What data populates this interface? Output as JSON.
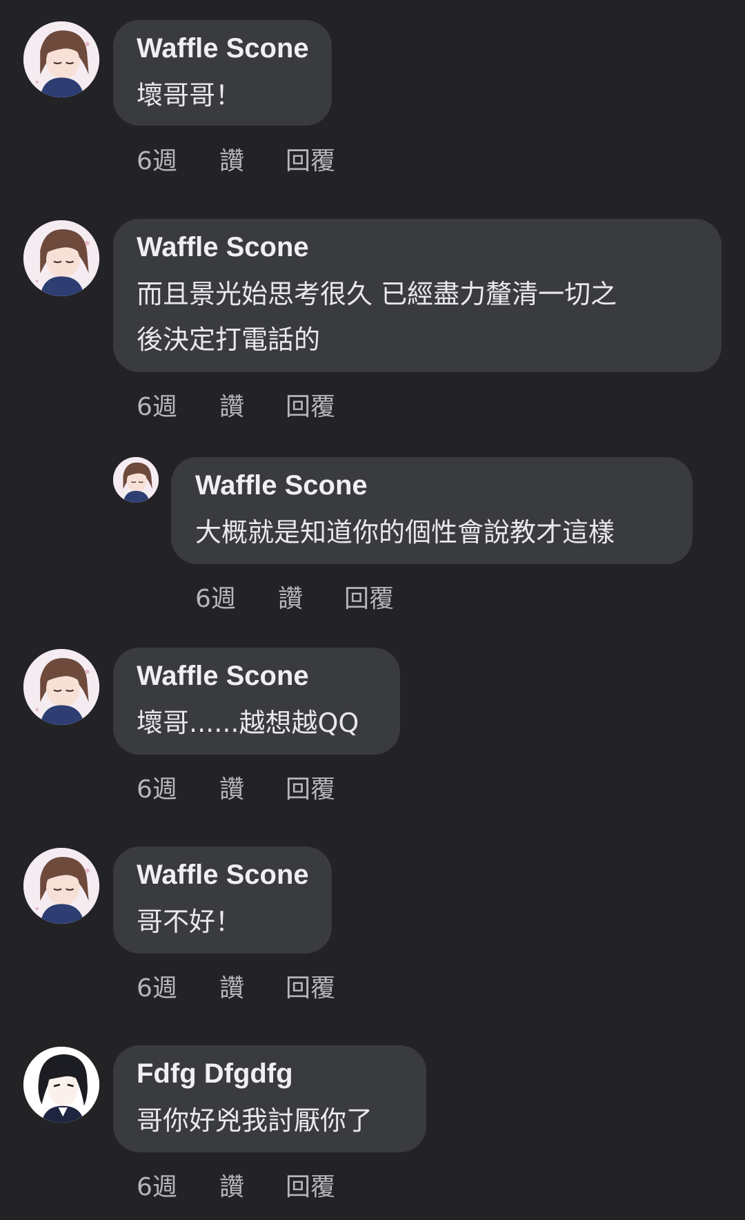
{
  "comments": [
    {
      "author": "Waffle Scone",
      "text": "壞哥哥！",
      "time": "6週",
      "like": "讚",
      "reply": "回覆"
    },
    {
      "author": "Waffle Scone",
      "text": "而且景光始思考很久 已經盡力釐清一切之\n後決定打電話的",
      "time": "6週",
      "like": "讚",
      "reply": "回覆"
    },
    {
      "author": "Waffle Scone",
      "text": "大概就是知道你的個性會說教才這樣",
      "time": "6週",
      "like": "讚",
      "reply": "回覆"
    },
    {
      "author": "Waffle Scone",
      "text": "壞哥......越想越QQ",
      "time": "6週",
      "like": "讚",
      "reply": "回覆"
    },
    {
      "author": "Waffle Scone",
      "text": "哥不好！",
      "time": "6週",
      "like": "讚",
      "reply": "回覆"
    },
    {
      "author": "Fdfg Dfgdfg",
      "text": "哥你好兇我討厭你了",
      "time": "6週",
      "like": "讚",
      "reply": "回覆"
    }
  ]
}
